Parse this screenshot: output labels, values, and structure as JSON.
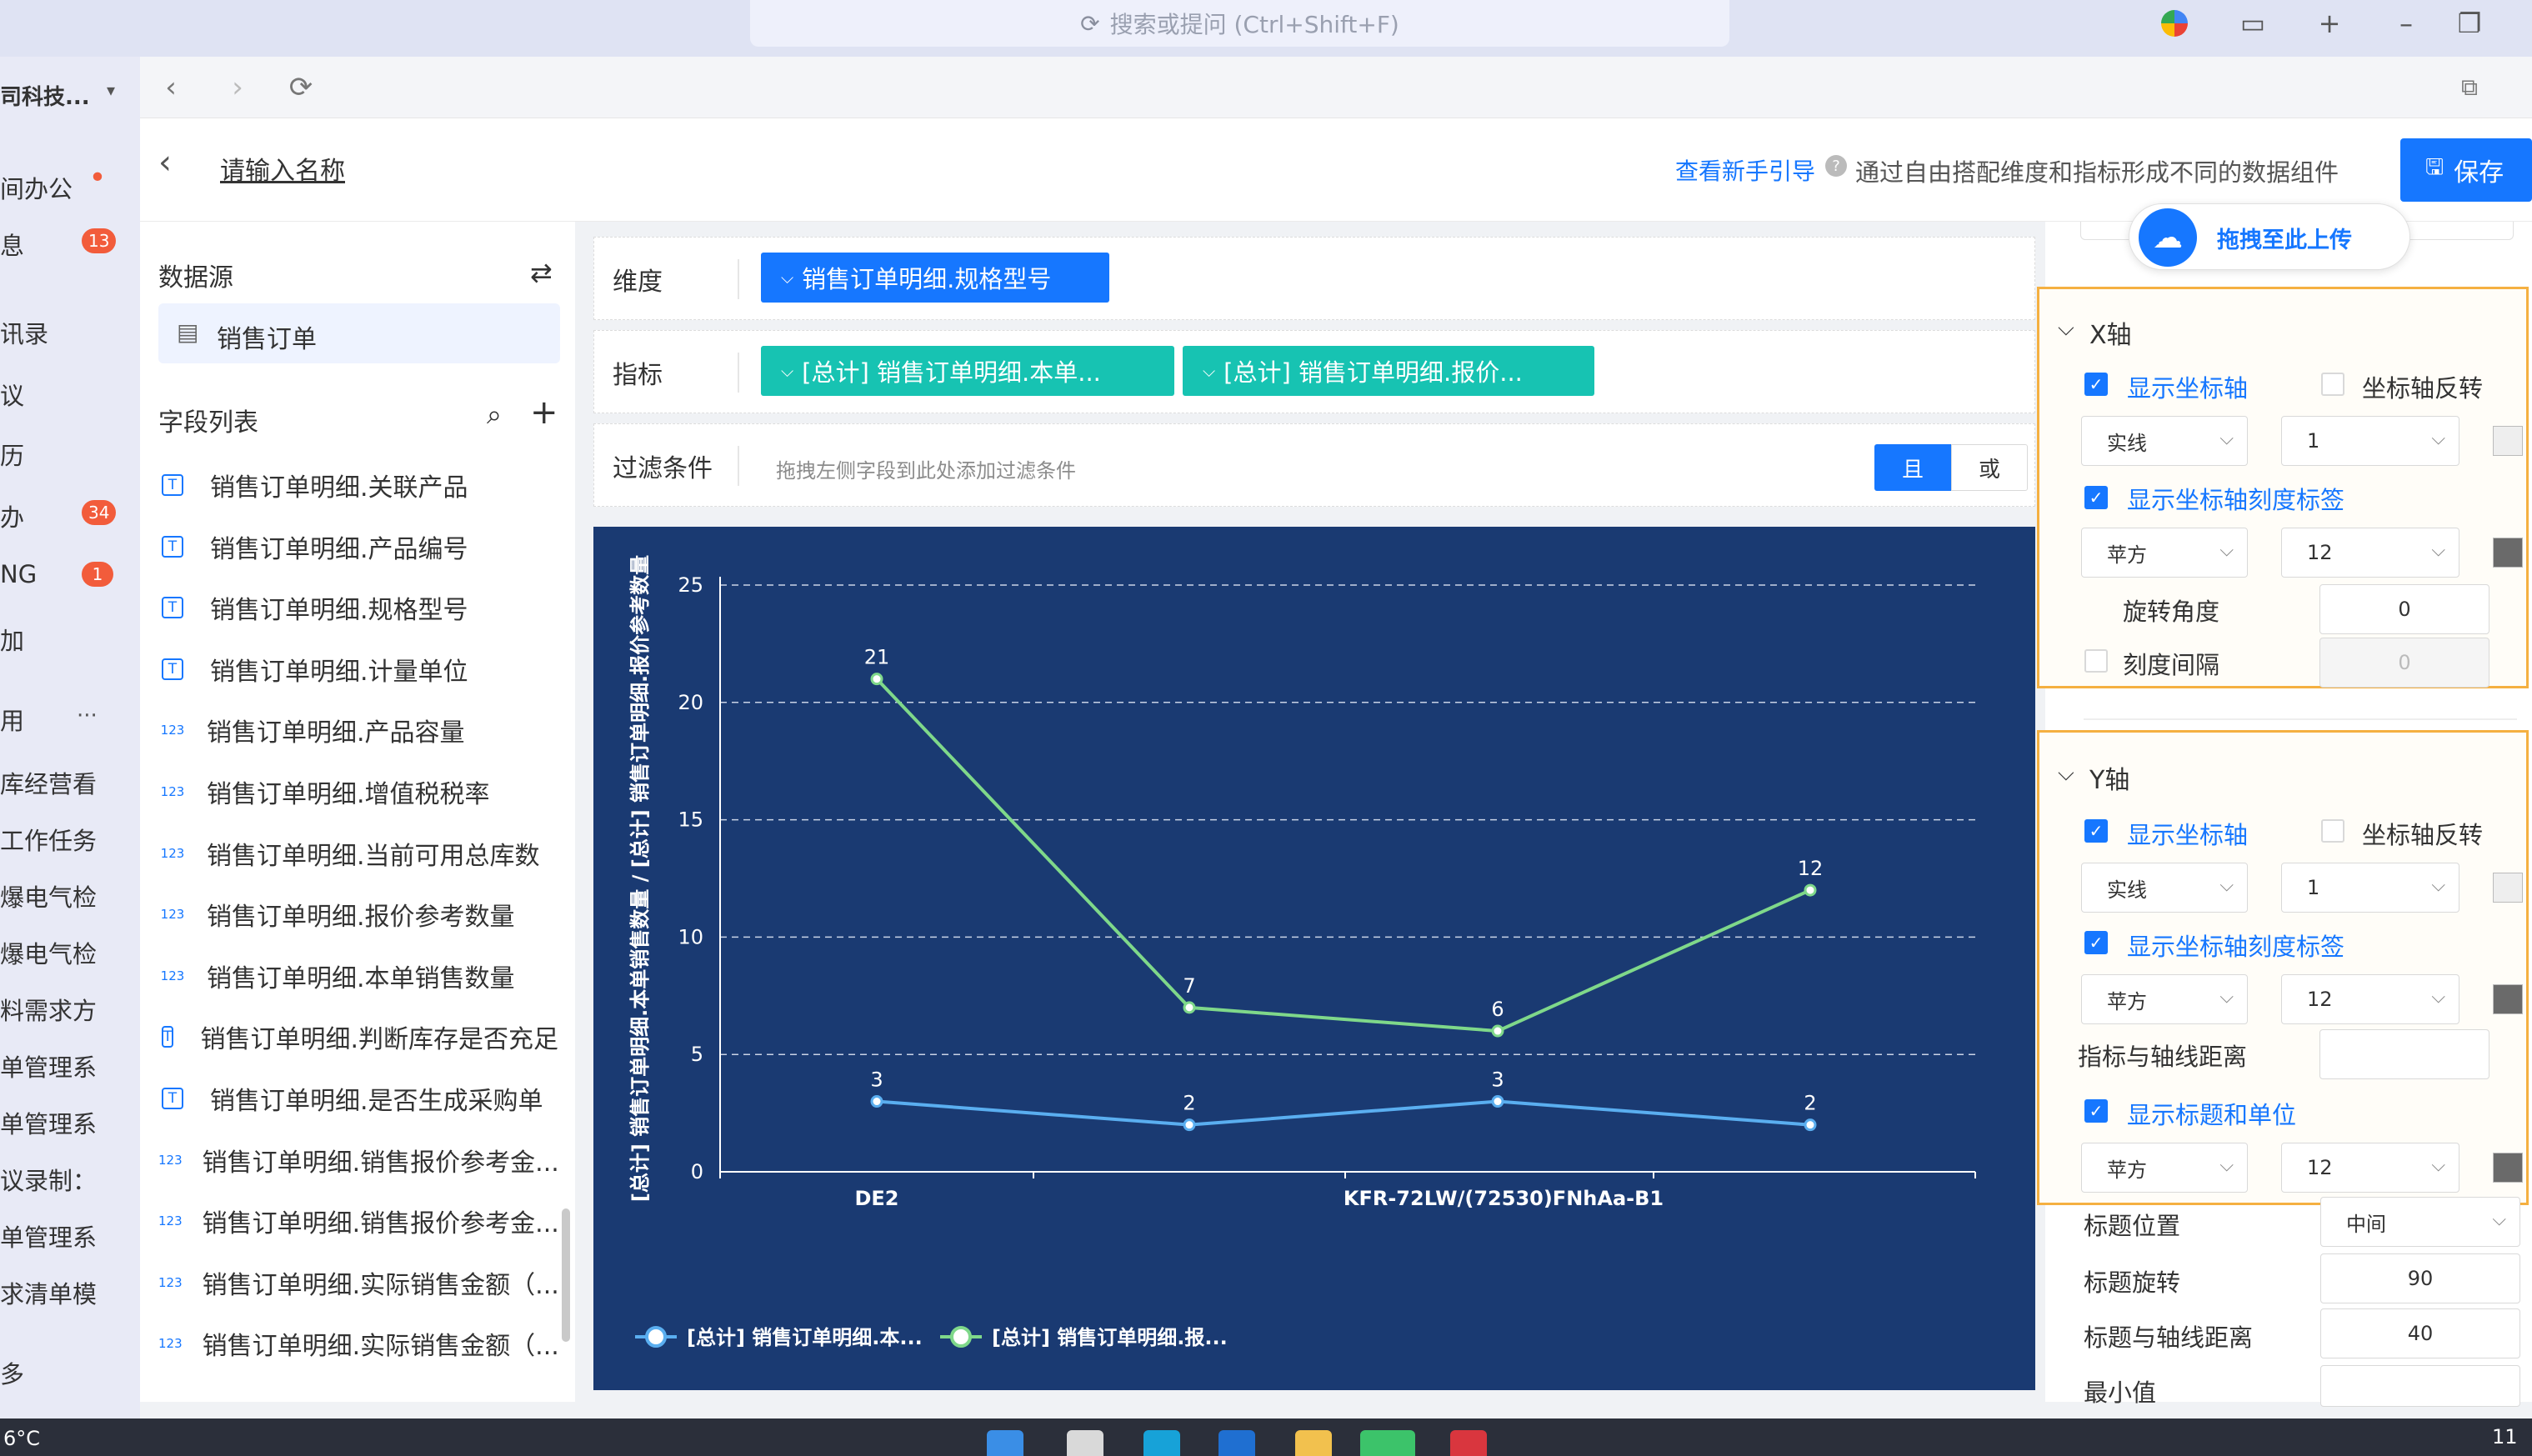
{
  "window": {
    "omnibox_placeholder": "搜索或提问 (Ctrl+Shift+F)",
    "nav_back": "‹",
    "nav_forward": "›",
    "nav_reload": "⟳"
  },
  "left_strip": {
    "company": "司科技...",
    "items": [
      {
        "label": "间办公",
        "badge": "•"
      },
      {
        "label": "息",
        "badge": "13"
      },
      {
        "label": "讯录",
        "badge": ""
      },
      {
        "label": "议",
        "badge": ""
      },
      {
        "label": "历",
        "badge": ""
      },
      {
        "label": "办",
        "badge": "34"
      },
      {
        "label": "NG",
        "badge": "1"
      },
      {
        "label": "加",
        "badge": ""
      },
      {
        "label": "用",
        "badge": "···"
      },
      {
        "label": "库经营看",
        "badge": ""
      },
      {
        "label": "工作任务",
        "badge": ""
      },
      {
        "label": "爆电气检",
        "badge": ""
      },
      {
        "label": "爆电气检",
        "badge": ""
      },
      {
        "label": "料需求方",
        "badge": ""
      },
      {
        "label": "单管理系",
        "badge": ""
      },
      {
        "label": "单管理系",
        "badge": ""
      },
      {
        "label": "议录制：",
        "badge": ""
      },
      {
        "label": "单管理系",
        "badge": ""
      },
      {
        "label": "求清单模",
        "badge": ""
      },
      {
        "label": "多",
        "badge": ""
      }
    ]
  },
  "header": {
    "back_icon": "chevron-left-icon",
    "name_placeholder": "请输入名称",
    "guide_link": "查看新手引导",
    "description": "通过自由搭配维度和指标形成不同的数据组件",
    "save_label": "保存"
  },
  "datasource": {
    "title": "数据源",
    "item": "销售订单"
  },
  "field_list": {
    "title": "字段列表",
    "fields": [
      {
        "type": "T",
        "label": "销售订单明细.关联产品"
      },
      {
        "type": "T",
        "label": "销售订单明细.产品编号"
      },
      {
        "type": "T",
        "label": "销售订单明细.规格型号"
      },
      {
        "type": "T",
        "label": "销售订单明细.计量单位"
      },
      {
        "type": "123",
        "label": "销售订单明细.产品容量"
      },
      {
        "type": "123",
        "label": "销售订单明细.增值税税率"
      },
      {
        "type": "123",
        "label": "销售订单明细.当前可用总库数"
      },
      {
        "type": "123",
        "label": "销售订单明细.报价参考数量"
      },
      {
        "type": "123",
        "label": "销售订单明细.本单销售数量"
      },
      {
        "type": "T",
        "label": "销售订单明细.判断库存是否充足"
      },
      {
        "type": "T",
        "label": "销售订单明细.是否生成采购单"
      },
      {
        "type": "123",
        "label": "销售订单明细.销售报价参考金..."
      },
      {
        "type": "123",
        "label": "销售订单明细.销售报价参考金..."
      },
      {
        "type": "123",
        "label": "销售订单明细.实际销售金额（..."
      },
      {
        "type": "123",
        "label": "销售订单明细.实际销售金额（..."
      }
    ]
  },
  "config": {
    "dimension_label": "维度",
    "dimension_pill": "销售订单明细.规格型号",
    "metric_label": "指标",
    "metric_pills": [
      "[总计] 销售订单明细.本单...",
      "[总计] 销售订单明细.报价..."
    ],
    "filter_label": "过滤条件",
    "filter_hint": "拖拽左侧字段到此处添加过滤条件",
    "and_label": "且",
    "or_label": "或"
  },
  "chart_data": {
    "type": "line",
    "categories": [
      "DE2",
      "",
      "KFR-72LW/(72530)FNhAa-B1",
      ""
    ],
    "tick_labels": [
      "DE2",
      "KFR-72LW/(72530)FNhAa-B1"
    ],
    "ylabel": "[总计] 销售订单明细.本单销售数量 / [总计] 销售订单明细.报价参考数量",
    "ylim": [
      0,
      25
    ],
    "yticks": [
      0,
      5,
      10,
      15,
      20,
      25
    ],
    "grid": true,
    "legend_position": "bottom-left",
    "series": [
      {
        "name": "[总计] 销售订单明细.本...",
        "values": [
          3,
          2,
          3,
          2
        ],
        "color": "#5aaef0"
      },
      {
        "name": "[总计] 销售订单明细.报...",
        "values": [
          21,
          7,
          6,
          12
        ],
        "color": "#7fd88a"
      }
    ],
    "background": "#1a3a72"
  },
  "right_panel": {
    "upload_label": "拖拽至此上传",
    "x_axis": {
      "title": "X轴",
      "show_axis": "显示坐标轴",
      "reverse_axis": "坐标轴反转",
      "line_style": "实线",
      "line_width": "1",
      "show_tick_labels": "显示坐标轴刻度标签",
      "font": "苹方",
      "font_size": "12",
      "rotate_label": "旋转角度",
      "rotate_value": "0",
      "interval_label": "刻度间隔",
      "interval_value": "0"
    },
    "y_axis": {
      "title": "Y轴",
      "show_axis": "显示坐标轴",
      "reverse_axis": "坐标轴反转",
      "line_style": "实线",
      "line_width": "1",
      "show_tick_labels": "显示坐标轴刻度标签",
      "font": "苹方",
      "font_size": "12",
      "metric_distance": "指标与轴线距离",
      "show_title_unit": "显示标题和单位",
      "title_font": "苹方",
      "title_font_size": "12"
    },
    "title_position_label": "标题位置",
    "title_position_value": "中间",
    "title_rotate_label": "标题旋转",
    "title_rotate_value": "90",
    "title_distance_label": "标题与轴线距离",
    "title_distance_value": "40",
    "min_value_label": "最小值"
  },
  "taskbar": {
    "temperature": "6°C",
    "time": "11"
  }
}
